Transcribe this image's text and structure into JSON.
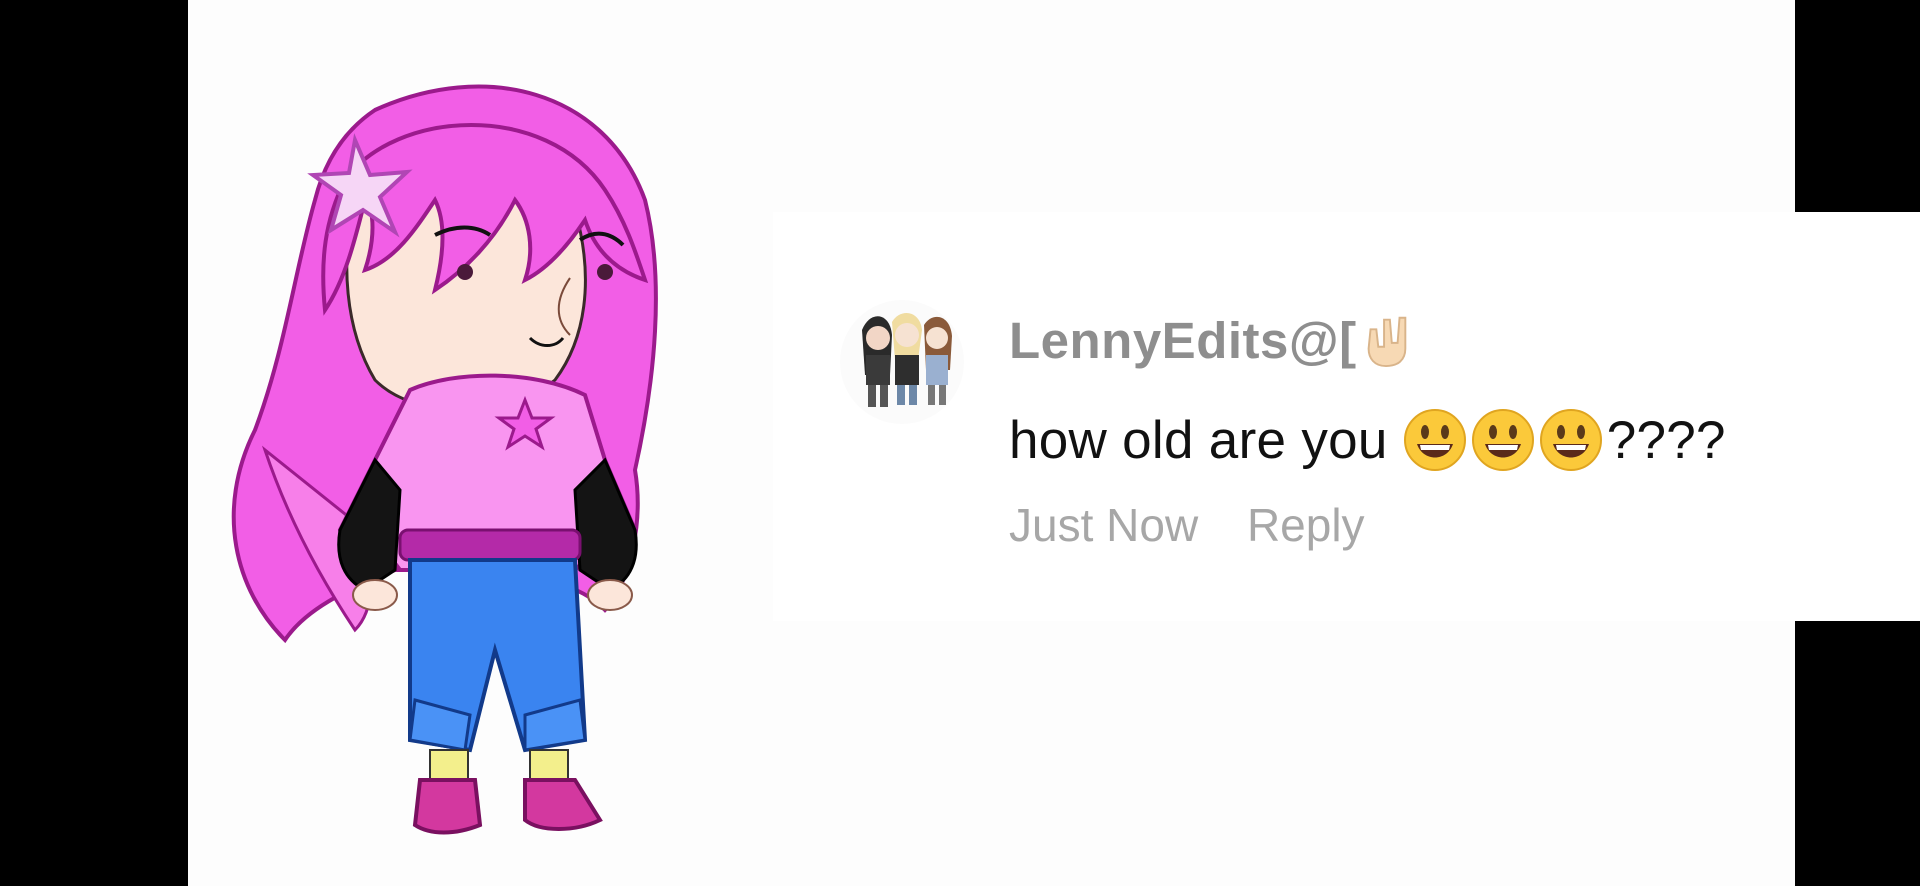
{
  "comment": {
    "username": "LennyEdits@[",
    "username_emoji": "hand-rock-sign-emoji",
    "text": "how old are you",
    "text_emojis": [
      "grinning-face-emoji",
      "grinning-face-emoji",
      "grinning-face-emoji"
    ],
    "text_suffix": "????",
    "timestamp": "Just Now",
    "reply_label": "Reply"
  },
  "colors": {
    "background": "#fdfdfd",
    "letterbox": "#000000",
    "username": "#8e8e8e",
    "meta": "#a7a7a7",
    "hair": "#f25ee6",
    "hoodie": "#f995f0",
    "jeans": "#3a84f0"
  }
}
